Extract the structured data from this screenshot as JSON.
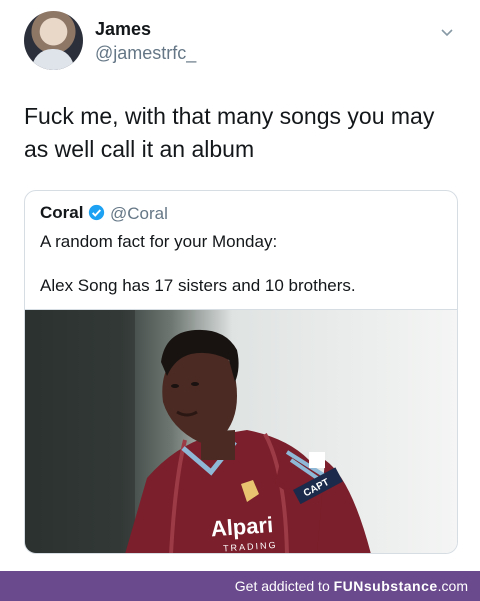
{
  "author": {
    "name": "James",
    "handle": "@jamestrfc_"
  },
  "tweet": {
    "line1": "Fuck me, with that many songs you may",
    "line2": "as well call it an album"
  },
  "quoted": {
    "name": "Coral",
    "handle": "@Coral",
    "line1": "A random fact for your Monday:",
    "line2": "Alex Song has 17 sisters and 10 brothers."
  },
  "photo": {
    "sponsor": "Alpari",
    "sponsor_sub": "TRADING",
    "badge": "CAPT"
  },
  "footer": {
    "prefix": "Get addicted to ",
    "brand": "FUNsubstance",
    "suffix": ".com"
  },
  "colors": {
    "footer_bg": "#6a4a8d",
    "verified": "#1da1f2",
    "shirt": "#7a1f2b"
  }
}
